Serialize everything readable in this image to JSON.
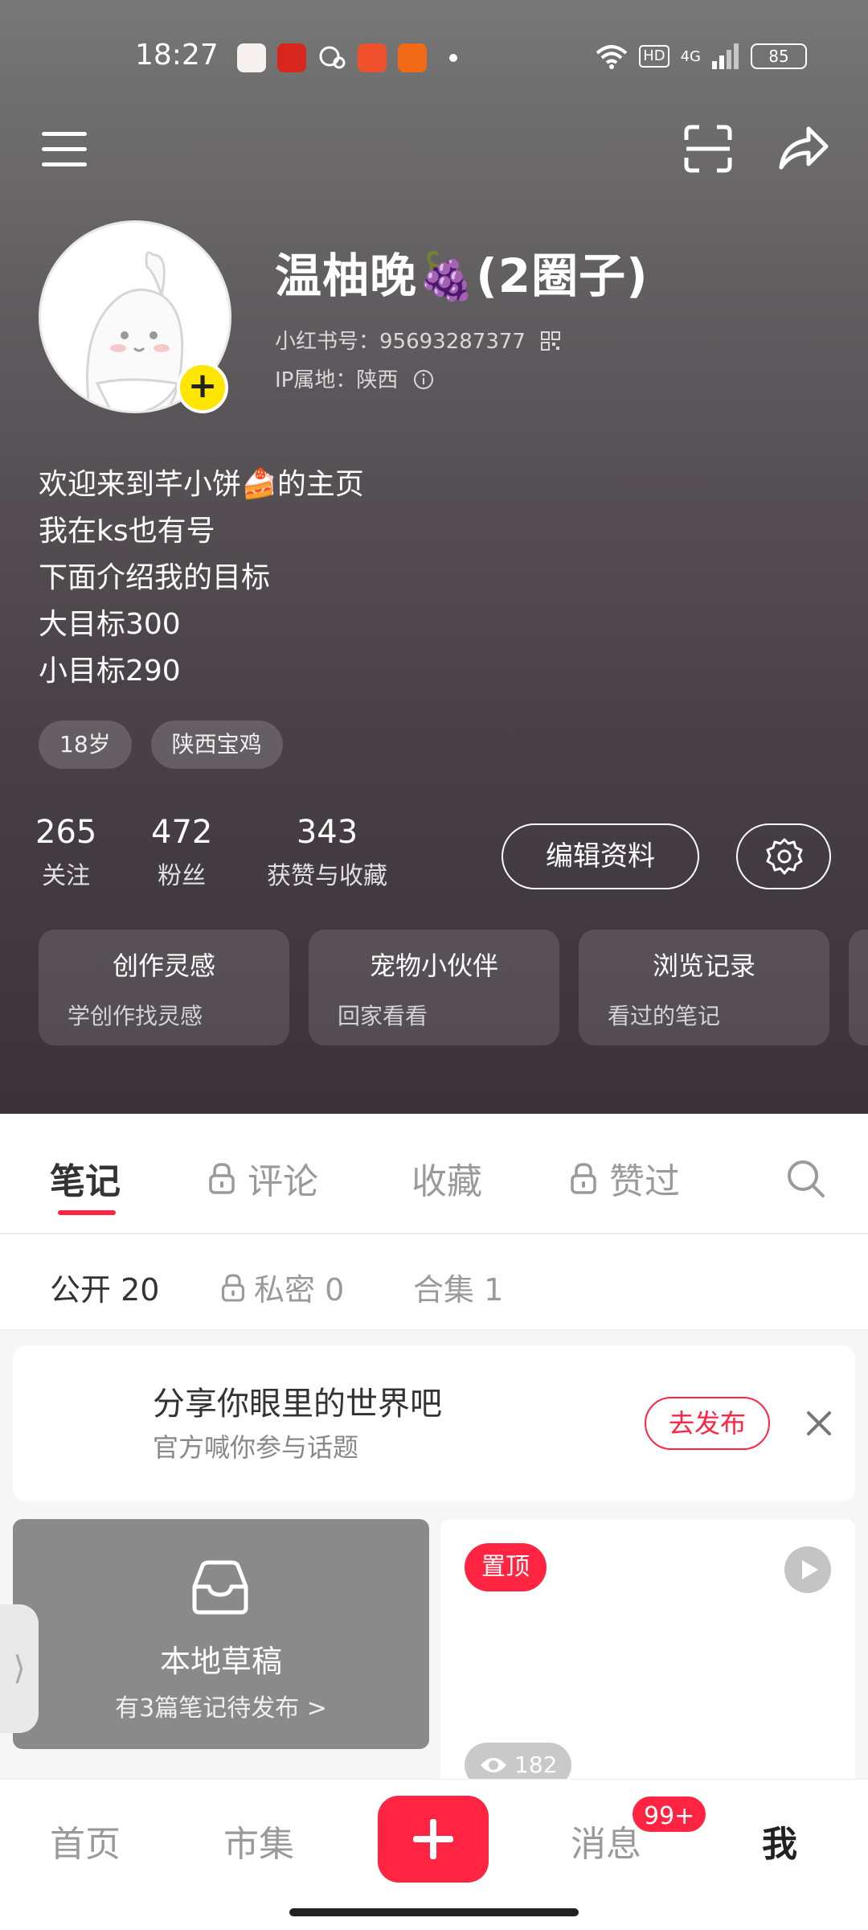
{
  "status_bar": {
    "time": "18:27",
    "network": "4G",
    "hd": "HD",
    "battery": "85"
  },
  "profile": {
    "nickname": "温柚晚🍇(2圈子)",
    "user_id": "小红书号：95693287377",
    "ip_location": "IP属地：陕西",
    "bio_lines": [
      "欢迎来到芊小饼🍰的主页",
      "我在ks也有号",
      "下面介绍我的目标",
      "大目标300",
      "小目标290"
    ],
    "tags": [
      "18岁",
      "陕西宝鸡"
    ]
  },
  "stats": [
    {
      "value": "265",
      "label": "关注"
    },
    {
      "value": "472",
      "label": "粉丝"
    },
    {
      "value": "343",
      "label": "获赞与收藏"
    }
  ],
  "actions": {
    "edit_profile": "编辑资料"
  },
  "feature_cards": [
    {
      "title": "创作灵感",
      "subtitle": "学创作找灵感"
    },
    {
      "title": "宠物小伙伴",
      "subtitle": "回家看看"
    },
    {
      "title": "浏览记录",
      "subtitle": "看过的笔记"
    }
  ],
  "tabs": [
    "笔记",
    "评论",
    "收藏",
    "赞过"
  ],
  "sub_tabs": [
    "公开 20",
    "私密 0",
    "合集 1"
  ],
  "prompt_banner": {
    "title": "分享你眼里的世界吧",
    "subtitle": "官方喊你参与话题",
    "button": "去发布"
  },
  "draft": {
    "title": "本地草稿",
    "subtitle": "有3篇笔记待发布 >"
  },
  "note": {
    "pin_label": "置顶",
    "views": "182"
  },
  "bottom_nav": {
    "home": "首页",
    "market": "市集",
    "messages": "消息",
    "messages_badge": "99+",
    "me": "我"
  },
  "colors": {
    "accent": "#ff2442",
    "avatar_plus": "#ffe600"
  }
}
